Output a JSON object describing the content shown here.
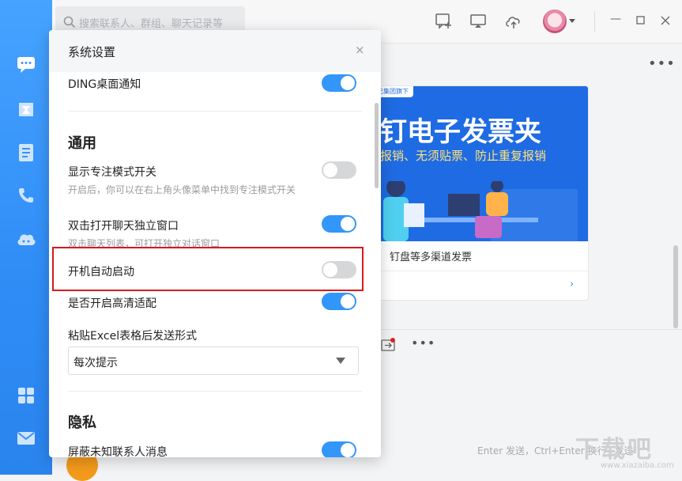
{
  "search": {
    "placeholder": "搜索联系人、群组、聊天记录等"
  },
  "chat": {
    "banner_title": "钉电子发票夹",
    "banner_subtitle": "报销、无须贴票、防止重复报销",
    "banner_tag": "已集团旗下",
    "card_desc": "钉盘等多渠道发票",
    "send_hint": "Enter 发送，Ctrl+Enter 换行",
    "send_label": "发送"
  },
  "watermark": {
    "main": "下载吧",
    "url": "www.xiazaiba.com"
  },
  "dialog": {
    "title": "系统设置",
    "close_icon": "×",
    "rows": {
      "ding": {
        "label": "DING桌面通知",
        "on": true
      },
      "focus": {
        "label": "显示专注模式开关",
        "desc": "开启后，你可以在右上角头像菜单中找到专注模式开关",
        "on": false
      },
      "dbl": {
        "label": "双击打开聊天独立窗口",
        "desc": "双击聊天列表，可打开独立对话窗口",
        "on": true
      },
      "autostart": {
        "label": "开机自动启动",
        "on": false
      },
      "hidpi": {
        "label": "是否开启高清适配",
        "on": true
      },
      "excel": {
        "label": "粘贴Excel表格后发送形式",
        "selected": "每次提示"
      },
      "unknown": {
        "label": "屏蔽未知联系人消息",
        "on": true
      }
    },
    "sections": {
      "general": "通用",
      "privacy": "隐私"
    }
  },
  "colors": {
    "accent": "#3296fa",
    "rail": "#2f8cf6",
    "highlight": "#d7191f"
  },
  "icons": [
    "message-icon",
    "work-icon",
    "contacts-icon",
    "phone-icon",
    "cloud-icon",
    "apps-icon",
    "mail-icon",
    "new-chat-icon",
    "screen-share-icon",
    "cloud-upload-icon",
    "chevron-down-icon",
    "minimize-icon",
    "maximize-icon",
    "close-icon"
  ]
}
